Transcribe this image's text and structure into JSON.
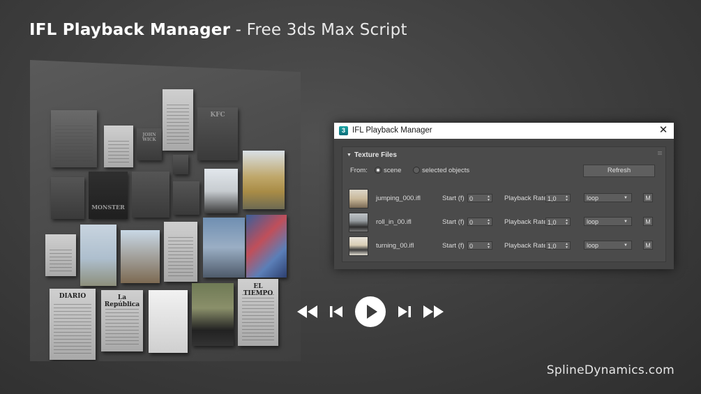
{
  "banner": {
    "title": "IFL Playback Manager",
    "separator": " - ",
    "subtitle": "Free 3ds Max Script"
  },
  "footer": {
    "brand": "SplineDynamics.com"
  },
  "wall_tiles": {
    "kfc": "KFC",
    "wick": "JOHN WICK",
    "monster": "MONSTER",
    "diario": "DIARIO",
    "republica": "La República",
    "tiempo": "EL TIEMPO"
  },
  "player": {
    "controls": [
      "rewind-icon",
      "skip-back-icon",
      "play-icon",
      "skip-forward-icon",
      "fast-forward-icon"
    ]
  },
  "dialog": {
    "app_icon": "3",
    "title": "IFL Playback Manager",
    "close_label": "✕",
    "rollout": {
      "title": "Texture Files",
      "from_label": "From:",
      "options": [
        "scene",
        "selected objects"
      ],
      "selected_option": "scene",
      "refresh_label": "Refresh",
      "start_label": "Start (f)",
      "rate_label": "Playback Rate",
      "m_label": "M",
      "files": [
        {
          "name": "jumping_000.ifl",
          "start": "0",
          "rate": "1,0",
          "mode": "loop"
        },
        {
          "name": "roll_in_00.ifl",
          "start": "0",
          "rate": "1,0",
          "mode": "loop"
        },
        {
          "name": "turning_00.ifl",
          "start": "0",
          "rate": "1,0",
          "mode": "loop"
        }
      ]
    }
  },
  "colors": {
    "background": "#404040",
    "dialog_bg": "#444444",
    "rollout_bg": "#4b4b4b",
    "titlebar_bg": "#ffffff",
    "text_light": "#dcdcdc"
  }
}
